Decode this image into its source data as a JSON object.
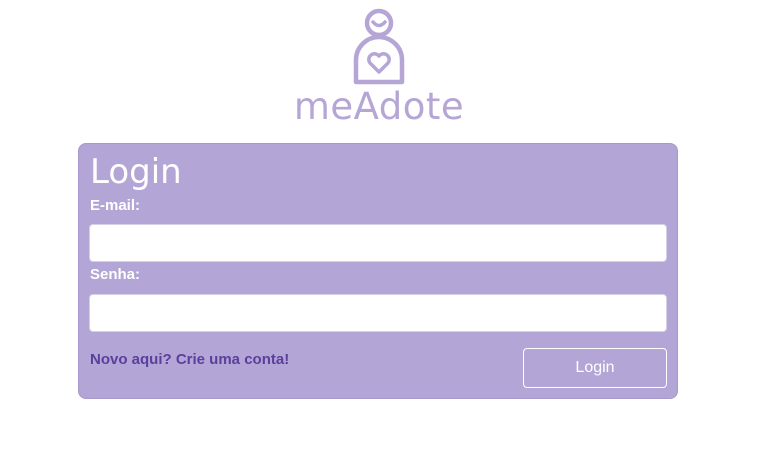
{
  "brand": {
    "logo_icon": "pregnant-heart-icon",
    "name": "meAdote",
    "color": "#b5a6d6"
  },
  "login_form": {
    "title": "Login",
    "email_label": "E-mail:",
    "email_value": "",
    "password_label": "Senha:",
    "password_value": "",
    "signup_link": "Novo aqui? Crie uma conta!",
    "submit_label": "Login",
    "card_color": "#b3a5d5",
    "link_color": "#5a3f9c"
  }
}
